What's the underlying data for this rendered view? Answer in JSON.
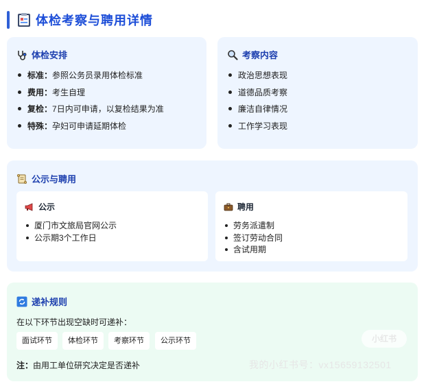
{
  "page": {
    "title": "体检考察与聘用详情"
  },
  "physical": {
    "heading": "体检安排",
    "items": [
      {
        "label": "标准：",
        "value": "参照公务员录用体检标准"
      },
      {
        "label": "费用：",
        "value": "考生自理"
      },
      {
        "label": "复检：",
        "value": "7日内可申请，以复检结果为准"
      },
      {
        "label": "特殊：",
        "value": "孕妇可申请延期体检"
      }
    ]
  },
  "inspection": {
    "heading": "考察内容",
    "items": [
      "政治思想表现",
      "道德品质考察",
      "廉洁自律情况",
      "工作学习表现"
    ]
  },
  "publicity": {
    "heading": "公示与聘用",
    "notice": {
      "heading": "公示",
      "items": [
        "厦门市文旅局官网公示",
        "公示期3个工作日"
      ]
    },
    "hiring": {
      "heading": "聘用",
      "items": [
        "劳务派遣制",
        "签订劳动合同",
        "含试用期"
      ]
    }
  },
  "replacement": {
    "heading": "递补规则",
    "intro": "在以下环节出现空缺时可递补：",
    "stages": [
      "面试环节",
      "体检环节",
      "考察环节",
      "公示环节"
    ],
    "note_label": "注：",
    "note_text": "由用工单位研究决定是否递补"
  },
  "watermark": {
    "badge": "小红书",
    "text": "我的小红书号：vx15659132501"
  },
  "icons": {
    "title": "clipboard-icon",
    "physical": "stethoscope-icon",
    "inspection": "magnifier-icon",
    "publicity": "scroll-icon",
    "notice": "megaphone-icon",
    "hiring": "briefcase-icon",
    "replacement": "refresh-icon"
  },
  "colors": {
    "accent": "#2f5fd6",
    "heading": "#1e40af",
    "card_blue": "#eef5ff",
    "card_green": "#ecfbf3"
  }
}
